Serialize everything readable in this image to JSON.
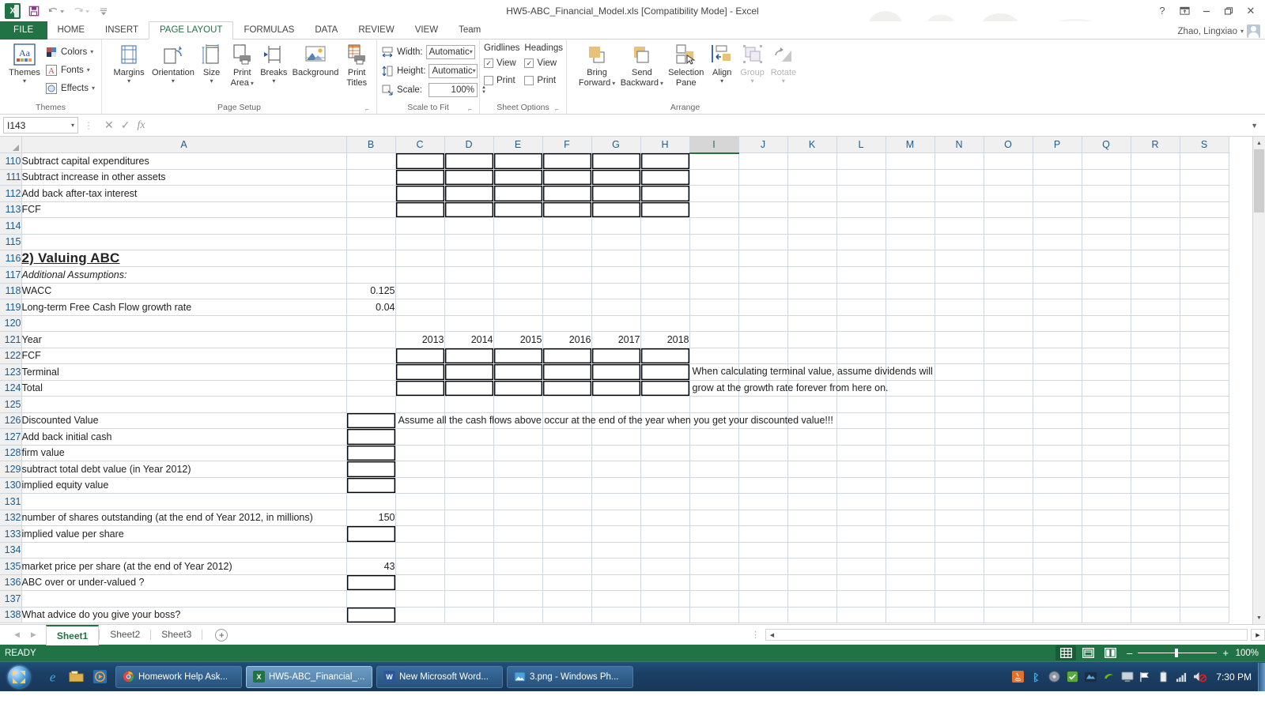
{
  "titlebar": {
    "document_title": "HW5-ABC_Financial_Model.xls  [Compatibility Mode] - Excel",
    "qat": {
      "save": "save-icon",
      "undo": "undo-icon",
      "redo": "redo-icon",
      "more": "customize-qat-icon"
    },
    "help": "?",
    "ribbon_display": "ribbon-display-icon",
    "minimize": "–",
    "restore": "restore-icon",
    "close": "✕",
    "user_name": "Zhao, Lingxiao"
  },
  "tabs": [
    {
      "label": "FILE",
      "active": false,
      "file": true
    },
    {
      "label": "HOME",
      "active": false
    },
    {
      "label": "INSERT",
      "active": false
    },
    {
      "label": "PAGE LAYOUT",
      "active": true
    },
    {
      "label": "FORMULAS",
      "active": false
    },
    {
      "label": "DATA",
      "active": false
    },
    {
      "label": "REVIEW",
      "active": false
    },
    {
      "label": "VIEW",
      "active": false
    },
    {
      "label": "Team",
      "active": false
    }
  ],
  "ribbon": {
    "themes": {
      "group_label": "Themes",
      "themes_button": "Themes",
      "colors": "Colors",
      "fonts": "Fonts",
      "effects": "Effects"
    },
    "page_setup": {
      "group_label": "Page Setup",
      "items": [
        {
          "label": "Margins",
          "dropdown": true
        },
        {
          "label": "Orientation",
          "dropdown": true
        },
        {
          "label": "Size",
          "dropdown": true
        },
        {
          "label": "Print\nArea",
          "line1": "Print",
          "line2": "Area",
          "dropdown": true
        },
        {
          "label": "Breaks",
          "dropdown": true
        },
        {
          "label": "Background",
          "dropdown": false
        },
        {
          "label": "Print\nTitles",
          "line1": "Print",
          "line2": "Titles",
          "dropdown": false
        }
      ]
    },
    "scale_to_fit": {
      "group_label": "Scale to Fit",
      "width_label": "Width:",
      "width_value": "Automatic",
      "height_label": "Height:",
      "height_value": "Automatic",
      "scale_label": "Scale:",
      "scale_value": "100%"
    },
    "sheet_options": {
      "group_label": "Sheet Options",
      "gridlines_label": "Gridlines",
      "headings_label": "Headings",
      "gridlines_view": "View",
      "gridlines_view_checked": true,
      "gridlines_print": "Print",
      "gridlines_print_checked": false,
      "headings_view": "View",
      "headings_view_checked": true,
      "headings_print": "Print",
      "headings_print_checked": false
    },
    "arrange": {
      "group_label": "Arrange",
      "bring_forward_l1": "Bring",
      "bring_forward_l2": "Forward",
      "send_backward_l1": "Send",
      "send_backward_l2": "Backward",
      "selection_pane_l1": "Selection",
      "selection_pane_l2": "Pane",
      "align": "Align",
      "group": "Group",
      "rotate": "Rotate"
    }
  },
  "formula_bar": {
    "name_box": "I143",
    "cancel_icon": "cancel-icon",
    "enter_icon": "enter-icon",
    "fx_icon": "fx-icon",
    "formula_value": "",
    "expand_icon": "expand-formula-bar-icon"
  },
  "grid": {
    "columns": [
      "A",
      "B",
      "C",
      "D",
      "E",
      "F",
      "G",
      "H",
      "I",
      "J",
      "K",
      "L",
      "M",
      "N",
      "O",
      "P",
      "Q",
      "R",
      "S"
    ],
    "selected_column": "I",
    "selected_cell": "I143",
    "rows": [
      {
        "n": "110",
        "a": "Subtract capital expenditures",
        "boxed_cdefgh": true
      },
      {
        "n": "111",
        "a": "Subtract increase in other assets",
        "boxed_cdefgh": true
      },
      {
        "n": "112",
        "a": "Add back after-tax interest",
        "boxed_cdefgh": true
      },
      {
        "n": "113",
        "a": "FCF",
        "bold": true,
        "boxed_cdefgh": true
      },
      {
        "n": "114",
        "a": ""
      },
      {
        "n": "115",
        "a": ""
      },
      {
        "n": "116",
        "a": "2) Valuing ABC",
        "heading": true
      },
      {
        "n": "117",
        "a": "Additional Assumptions:",
        "italic": true
      },
      {
        "n": "118",
        "a": "WACC",
        "b": "0.125"
      },
      {
        "n": "119",
        "a": "Long-term Free Cash Flow growth rate",
        "b": "0.04"
      },
      {
        "n": "120",
        "a": ""
      },
      {
        "n": "121",
        "a": "Year",
        "bold": true,
        "years": [
          "2013",
          "2014",
          "2015",
          "2016",
          "2017",
          "2018"
        ]
      },
      {
        "n": "122",
        "a": "FCF",
        "boxed_cdefgh": true
      },
      {
        "n": "123",
        "a": "Terminal",
        "boxed_cdefgh": true,
        "note": "When calculating terminal value, assume dividends will"
      },
      {
        "n": "124",
        "a": "Total",
        "boxed_cdefgh": true,
        "note": "grow at the growth rate forever from here on."
      },
      {
        "n": "125",
        "a": ""
      },
      {
        "n": "126",
        "a": "Discounted Value",
        "bold": true,
        "boxed_b": true,
        "note": "Assume all the cash flows above occur at the end of the year when you get your discounted value!!!"
      },
      {
        "n": "127",
        "a": "Add back initial cash",
        "boxed_b": true
      },
      {
        "n": "128",
        "a": "firm value",
        "boxed_b": true
      },
      {
        "n": "129",
        "a": "subtract total debt value (in Year 2012)",
        "boxed_b": true
      },
      {
        "n": "130",
        "a": "implied equity value",
        "bold": true,
        "boxed_b": true
      },
      {
        "n": "131",
        "a": ""
      },
      {
        "n": "132",
        "a": "number of shares outstanding (at the end of Year 2012, in millions)",
        "b": "150"
      },
      {
        "n": "133",
        "a": "implied value per share",
        "bold": true,
        "boxed_b": true
      },
      {
        "n": "134",
        "a": ""
      },
      {
        "n": "135",
        "a": "market price per share (at the end of Year 2012)",
        "b": "43"
      },
      {
        "n": "136",
        "a": "ABC over or under-valued ?",
        "bold": true,
        "boxed_b": true
      },
      {
        "n": "137",
        "a": ""
      },
      {
        "n": "138",
        "a": "What advice do you give your boss?",
        "boxed_b": true
      }
    ]
  },
  "sheet_tabs": {
    "prev_icon": "prev-sheet-icon",
    "next_icon": "next-sheet-icon",
    "tabs": [
      {
        "label": "Sheet1",
        "active": true
      },
      {
        "label": "Sheet2",
        "active": false
      },
      {
        "label": "Sheet3",
        "active": false
      }
    ],
    "add_sheet": "+"
  },
  "status_bar": {
    "mode": "READY",
    "views": [
      "normal-view-icon",
      "page-layout-view-icon",
      "page-break-preview-icon"
    ],
    "active_view": "normal-view-icon",
    "zoom_out": "–",
    "zoom_in": "+",
    "zoom_level": "100%"
  },
  "taskbar": {
    "start": "start-orb-icon",
    "quick_launch": [
      "internet-explorer-icon",
      "folder-icon",
      "media-player-icon"
    ],
    "items": [
      {
        "label": "Homework Help Ask...",
        "icon": "chrome-icon",
        "active": false
      },
      {
        "label": "HW5-ABC_Financial_...",
        "icon": "excel-icon",
        "active": true
      },
      {
        "label": "New Microsoft Word...",
        "icon": "word-icon",
        "active": false
      },
      {
        "label": "3.png - Windows Ph...",
        "icon": "photo-viewer-icon",
        "active": false
      }
    ],
    "tray": [
      "java-icon",
      "bluetooth-icon",
      "disc-icon",
      "security-icon",
      "graphics-icon",
      "display-icon",
      "flag-icon",
      "battery-icon",
      "network-icon",
      "volume-muted-icon"
    ],
    "clock": "7:30 PM",
    "show_desktop": "show-desktop-button"
  }
}
